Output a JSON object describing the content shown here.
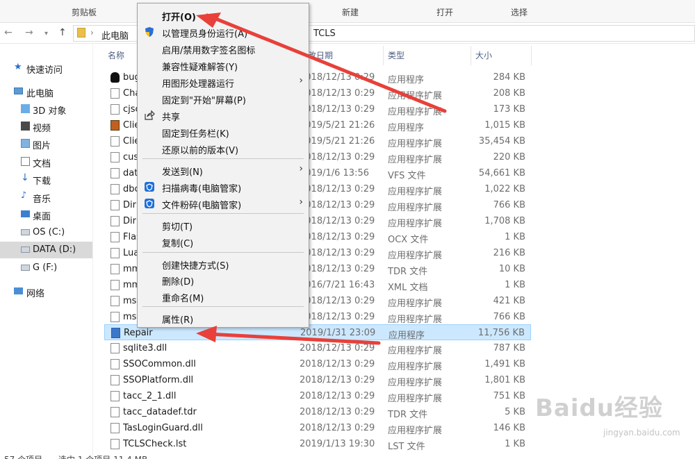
{
  "ribbon": {
    "clipboard": "剪贴板",
    "new": "新建",
    "open": "打开",
    "select": "选择"
  },
  "address": {
    "crumb1": "此电脑",
    "crumb_last": "TCLS"
  },
  "navpane": {
    "items": [
      {
        "label": "快速访问",
        "icon": "star-icon"
      },
      {
        "label": "此电脑",
        "icon": "computer-icon"
      },
      {
        "label": "3D 对象",
        "icon": "3d-objects-icon"
      },
      {
        "label": "视频",
        "icon": "video-icon"
      },
      {
        "label": "图片",
        "icon": "picture-icon"
      },
      {
        "label": "文档",
        "icon": "document-icon"
      },
      {
        "label": "下载",
        "icon": "download-icon"
      },
      {
        "label": "音乐",
        "icon": "music-icon"
      },
      {
        "label": "桌面",
        "icon": "desktop-icon"
      },
      {
        "label": "OS (C:)",
        "icon": "drive-icon"
      },
      {
        "label": "DATA (D:)",
        "icon": "drive-icon"
      },
      {
        "label": "G (F:)",
        "icon": "drive-icon"
      },
      {
        "label": "网络",
        "icon": "network-icon"
      }
    ]
  },
  "columns": {
    "name": "名称",
    "date": "修改日期",
    "type": "类型",
    "size": "大小"
  },
  "files": [
    {
      "name": "bug",
      "date": "2018/12/13 0:29",
      "type": "应用程序",
      "size": "284 KB"
    },
    {
      "name": "Cha",
      "date": "2018/12/13 0:29",
      "type": "应用程序扩展",
      "size": "208 KB"
    },
    {
      "name": "cjsc",
      "date": "2018/12/13 0:29",
      "type": "应用程序扩展",
      "size": "173 KB"
    },
    {
      "name": "Clie",
      "date": "2019/5/21 21:26",
      "type": "应用程序",
      "size": "1,015 KB"
    },
    {
      "name": "Clie",
      "date": "2019/5/21 21:26",
      "type": "应用程序扩展",
      "size": "35,454 KB"
    },
    {
      "name": "cus",
      "date": "2018/12/13 0:29",
      "type": "应用程序扩展",
      "size": "220 KB"
    },
    {
      "name": "dat",
      "date": "2019/1/6 13:56",
      "type": "VFS 文件",
      "size": "54,661 KB"
    },
    {
      "name": "dbc",
      "date": "2018/12/13 0:29",
      "type": "应用程序扩展",
      "size": "1,022 KB"
    },
    {
      "name": "Dir",
      "date": "2018/12/13 0:29",
      "type": "应用程序扩展",
      "size": "766 KB"
    },
    {
      "name": "Dir",
      "date": "2018/12/13 0:29",
      "type": "应用程序扩展",
      "size": "1,708 KB"
    },
    {
      "name": "Flas",
      "date": "2018/12/13 0:29",
      "type": "OCX 文件",
      "size": "1 KB"
    },
    {
      "name": "Lua",
      "date": "2018/12/13 0:29",
      "type": "应用程序扩展",
      "size": "216 KB"
    },
    {
      "name": "mm",
      "date": "2018/12/13 0:29",
      "type": "TDR 文件",
      "size": "10 KB"
    },
    {
      "name": "mm",
      "date": "2016/7/21 16:43",
      "type": "XML 文档",
      "size": "1 KB"
    },
    {
      "name": "ms",
      "date": "2018/12/13 0:29",
      "type": "应用程序扩展",
      "size": "421 KB"
    },
    {
      "name": "ms",
      "date": "2018/12/13 0:29",
      "type": "应用程序扩展",
      "size": "766 KB"
    },
    {
      "name": "Repair",
      "date": "2019/1/31 23:09",
      "type": "应用程序",
      "size": "11,756 KB"
    },
    {
      "name": "sqlite3.dll",
      "date": "2018/12/13 0:29",
      "type": "应用程序扩展",
      "size": "787 KB"
    },
    {
      "name": "SSOCommon.dll",
      "date": "2018/12/13 0:29",
      "type": "应用程序扩展",
      "size": "1,491 KB"
    },
    {
      "name": "SSOPlatform.dll",
      "date": "2018/12/13 0:29",
      "type": "应用程序扩展",
      "size": "1,801 KB"
    },
    {
      "name": "tacc_2_1.dll",
      "date": "2018/12/13 0:29",
      "type": "应用程序扩展",
      "size": "751 KB"
    },
    {
      "name": "tacc_datadef.tdr",
      "date": "2018/12/13 0:29",
      "type": "TDR 文件",
      "size": "5 KB"
    },
    {
      "name": "TasLoginGuard.dll",
      "date": "2018/12/13 0:29",
      "type": "应用程序扩展",
      "size": "146 KB"
    },
    {
      "name": "TCLSCheck.lst",
      "date": "2019/1/13 19:30",
      "type": "LST 文件",
      "size": "1 KB"
    }
  ],
  "menu": {
    "open": "打开(O)",
    "run_as_admin": "以管理员身份运行(A)",
    "toggle_signature": "启用/禁用数字签名图标",
    "compat": "兼容性疑难解答(Y)",
    "gpu_run": "用图形处理器运行",
    "pin_start": "固定到\"开始\"屏幕(P)",
    "share": "共享",
    "pin_taskbar": "固定到任务栏(K)",
    "restore": "还原以前的版本(V)",
    "send_to": "发送到(N)",
    "scan": "扫描病毒(电脑管家)",
    "shred": "文件粉碎(电脑管家)",
    "cut": "剪切(T)",
    "copy": "复制(C)",
    "shortcut": "创建快捷方式(S)",
    "delete": "删除(D)",
    "rename": "重命名(M)",
    "properties": "属性(R)"
  },
  "status": {
    "count": "57 个项目",
    "selected": "选中 1 个项目 11.4 MB"
  },
  "watermark": {
    "brand": "Baidu经验",
    "url": "jingyan.baidu.com"
  },
  "colors": {
    "selected_row": "#cce8ff",
    "arrow": "#e8403a",
    "guard_blue": "#1e6fd9"
  }
}
